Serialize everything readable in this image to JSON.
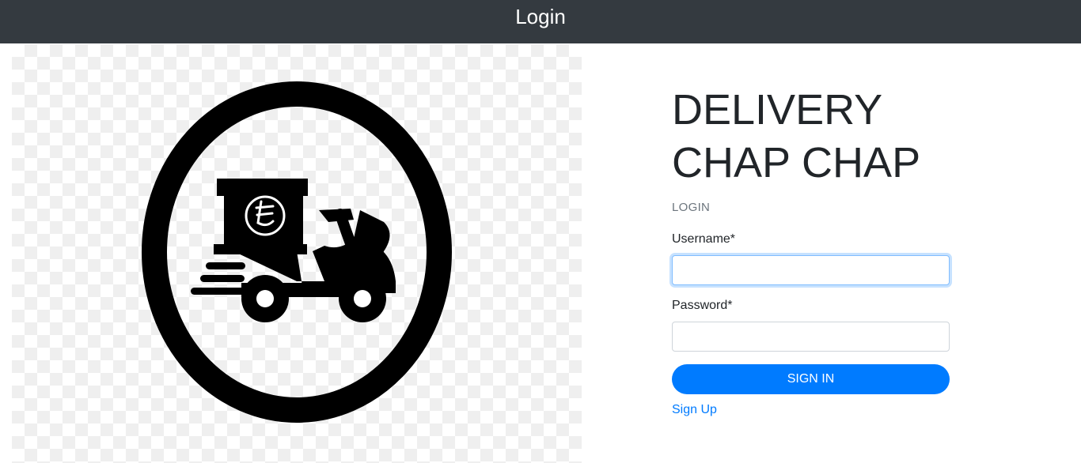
{
  "header": {
    "title": "Login"
  },
  "brand": {
    "title": "DELIVERY\nCHAP CHAP",
    "logo_icon": "delivery-scooter-logo"
  },
  "login_form": {
    "section_label": "LOGIN",
    "username_label": "Username*",
    "username_value": "",
    "password_label": "Password*",
    "password_value": "",
    "submit_label": "SIGN IN",
    "signup_link": "Sign Up"
  },
  "colors": {
    "header_bg": "#343a40",
    "accent": "#007bff",
    "text": "#212529",
    "muted": "#6c757d"
  }
}
